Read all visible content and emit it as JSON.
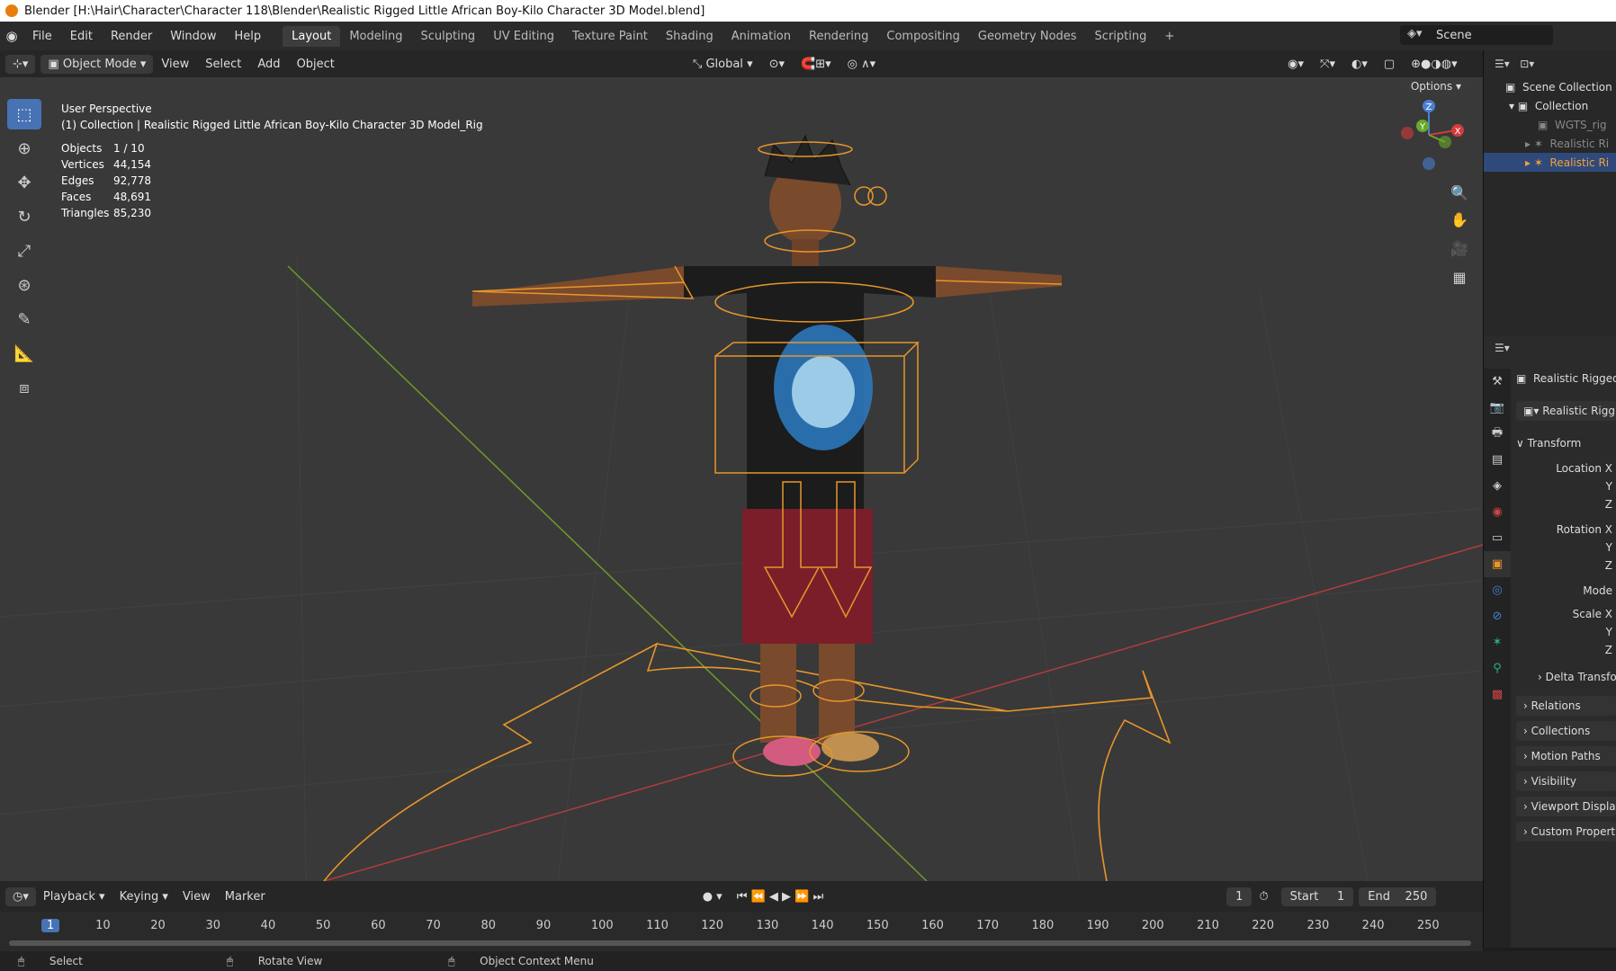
{
  "window_title": "Blender [H:\\Hair\\Character\\Character 118\\Blender\\Realistic Rigged Little African Boy-Kilo Character 3D Model.blend]",
  "menu": [
    "File",
    "Edit",
    "Render",
    "Window",
    "Help"
  ],
  "workspaces": [
    "Layout",
    "Modeling",
    "Sculpting",
    "UV Editing",
    "Texture Paint",
    "Shading",
    "Animation",
    "Rendering",
    "Compositing",
    "Geometry Nodes",
    "Scripting"
  ],
  "active_workspace": "Layout",
  "scene_name": "Scene",
  "viewport": {
    "mode": "Object Mode",
    "menus": [
      "View",
      "Select",
      "Add",
      "Object"
    ],
    "orientation": "Global",
    "options_label": "Options",
    "perspective": "User Perspective",
    "context": "(1) Collection | Realistic Rigged Little African Boy-Kilo Character 3D Model_Rig",
    "stats": [
      {
        "k": "Objects",
        "v": "1 / 10"
      },
      {
        "k": "Vertices",
        "v": "44,154"
      },
      {
        "k": "Edges",
        "v": "92,778"
      },
      {
        "k": "Faces",
        "v": "48,691"
      },
      {
        "k": "Triangles",
        "v": "85,230"
      }
    ],
    "gizmo_axes": [
      "Z",
      "Y",
      "X"
    ]
  },
  "outliner": {
    "scene_collection": "Scene Collection",
    "collection": "Collection",
    "items": [
      "WGTS_rig",
      "Realistic Ri",
      "Realistic Ri"
    ]
  },
  "properties": {
    "object_name": "Realistic Rigged",
    "data_name": "Realistic Rigg",
    "transform": "Transform",
    "location": [
      "Location X",
      "Y",
      "Z"
    ],
    "rotation": [
      "Rotation X",
      "Y",
      "Z"
    ],
    "mode": "Mode",
    "scale": [
      "Scale X",
      "Y",
      "Z"
    ],
    "delta": "Delta Transfor",
    "sections": [
      "Relations",
      "Collections",
      "Motion Paths",
      "Visibility",
      "Viewport Display",
      "Custom Properti"
    ]
  },
  "timeline": {
    "menus": [
      "Playback",
      "Keying",
      "View",
      "Marker"
    ],
    "current_frame": "1",
    "start_label": "Start",
    "start": "1",
    "end_label": "End",
    "end": "250",
    "ticks": [
      "1",
      "10",
      "20",
      "30",
      "40",
      "50",
      "60",
      "70",
      "80",
      "90",
      "100",
      "110",
      "120",
      "130",
      "140",
      "150",
      "160",
      "170",
      "180",
      "190",
      "200",
      "210",
      "220",
      "230",
      "240",
      "250"
    ]
  },
  "statusbar": [
    "Select",
    "Rotate View",
    "Object Context Menu"
  ],
  "colors": {
    "accent": "#4772b3",
    "rig": "#e8962a",
    "x_axis": "#b53c3c",
    "y_axis": "#6e9a2c"
  }
}
